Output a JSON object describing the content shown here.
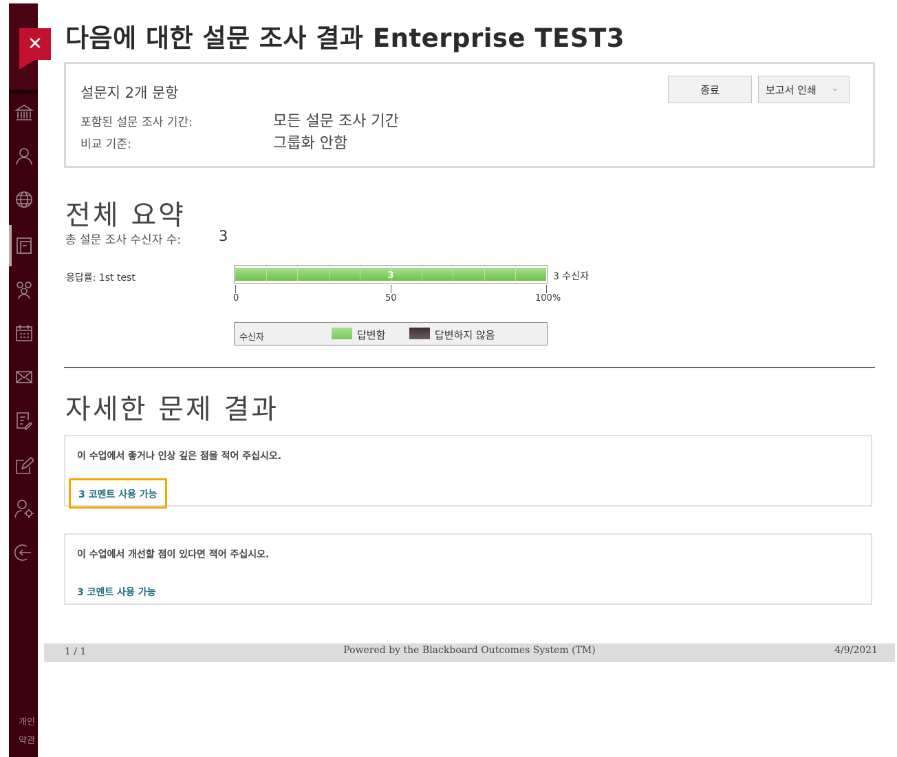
{
  "window": {
    "close_symbol": "✕"
  },
  "sidebar": {
    "icons": [
      "institution-icon",
      "user-icon",
      "globe-icon",
      "courses-icon",
      "groups-icon",
      "calendar-icon",
      "mail-icon",
      "grades-icon",
      "edit-icon",
      "tools-icon",
      "logout-icon"
    ],
    "footer_lines": [
      "개인",
      "약관"
    ]
  },
  "page": {
    "title": "다음에 대한 설문 조사 결과 Enterprise TEST3"
  },
  "info": {
    "question_count": "설문지 2개 문항",
    "period_label": "포함된 설문 조사 기간:",
    "period_value": "모든 설문 조사 기간",
    "compare_label": "비교 기준:",
    "compare_value": "그룹화 안함",
    "end_button": "종료",
    "print_button": "보고서 인쇄",
    "print_chevron": "⌄"
  },
  "summary": {
    "heading": "전체 요약",
    "recipients_label": "총 설문 조사 수신자 수:",
    "recipients_value": "3"
  },
  "chart_data": {
    "type": "bar",
    "orientation": "horizontal",
    "categories": [
      "응답률: 1st test"
    ],
    "series": [
      {
        "name": "답변함",
        "values": [
          100
        ],
        "data_label": "3",
        "color": "#7ac95a"
      },
      {
        "name": "답변하지 않음",
        "values": [
          0
        ],
        "color": "#6b5a62"
      }
    ],
    "xlim": [
      0,
      100
    ],
    "tick_labels": [
      "0",
      "50",
      "100%"
    ],
    "tick_values": [
      0,
      50,
      100
    ],
    "bar_annotation": "3 수신자",
    "legend_title": "수신자",
    "legend_position": "bottom"
  },
  "details": {
    "heading": "자세한 문제 결과",
    "questions": [
      {
        "text": "이 수업에서 좋거나 인상 깊은 점을 적어 주십시오.",
        "link": "3 코멘트 사용 가능"
      },
      {
        "text": "이 수업에서 개선할 점이 있다면 적어 주십시오.",
        "link": "3 코멘트 사용 가능"
      }
    ]
  },
  "footer": {
    "page": "1 / 1",
    "center": "Powered by the Blackboard Outcomes System (TM)",
    "date": "4/9/2021"
  }
}
